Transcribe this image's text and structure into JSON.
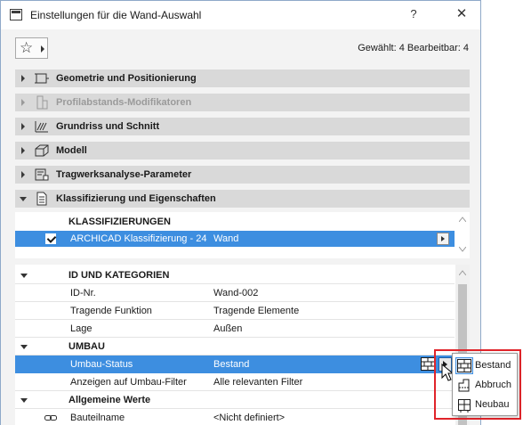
{
  "window": {
    "title": "Einstellungen für die Wand-Auswahl",
    "help_label": "?",
    "close_label": "✕"
  },
  "toolbar": {
    "favorites_icon": "star-icon",
    "selection_info": "Gewählt: 4 Bearbeitbar: 4"
  },
  "panels": [
    {
      "label": "Geometrie und Positionierung",
      "icon": "geometry-icon",
      "expanded": false,
      "enabled": true
    },
    {
      "label": "Profilabstands-Modifikatoren",
      "icon": "profile-modifier-icon",
      "expanded": false,
      "enabled": false
    },
    {
      "label": "Grundriss und Schnitt",
      "icon": "floorplan-section-icon",
      "expanded": false,
      "enabled": true
    },
    {
      "label": "Modell",
      "icon": "model-icon",
      "expanded": false,
      "enabled": true
    },
    {
      "label": "Tragwerksanalyse-Parameter",
      "icon": "structural-analysis-icon",
      "expanded": false,
      "enabled": true
    },
    {
      "label": "Klassifizierung und Eigenschaften",
      "icon": "classification-icon",
      "expanded": true,
      "enabled": true
    }
  ],
  "classifications": {
    "header": "KLASSIFIZIERUNGEN",
    "rows": [
      {
        "checked": true,
        "name": "ARCHICAD Klassifizierung - 24",
        "value": "Wand"
      }
    ]
  },
  "properties": {
    "groups": [
      {
        "title": "ID UND KATEGORIEN",
        "rows": [
          {
            "label": "ID-Nr.",
            "value": "Wand-002"
          },
          {
            "label": "Tragende Funktion",
            "value": "Tragende Elemente"
          },
          {
            "label": "Lage",
            "value": "Außen"
          }
        ]
      },
      {
        "title": "UMBAU",
        "rows": [
          {
            "label": "Umbau-Status",
            "value": "Bestand",
            "selected": true
          },
          {
            "label": "Anzeigen auf Umbau-Filter",
            "value": "Alle relevanten Filter"
          }
        ]
      },
      {
        "title": "Allgemeine Werte",
        "rows": [
          {
            "label": "Bauteilname",
            "value": "<Nicht definiert>",
            "icon": "link-icon"
          }
        ]
      }
    ]
  },
  "renovation_popup": {
    "items": [
      {
        "label": "Bestand",
        "icon": "brick-wall-icon",
        "current": true
      },
      {
        "label": "Abbruch",
        "icon": "demolish-icon",
        "current": false
      },
      {
        "label": "Neubau",
        "icon": "new-construction-icon",
        "current": false
      }
    ]
  },
  "colors": {
    "selection": "#3d8ee0",
    "panel_header": "#d9d9d9",
    "highlight_frame": "#e0242a"
  }
}
